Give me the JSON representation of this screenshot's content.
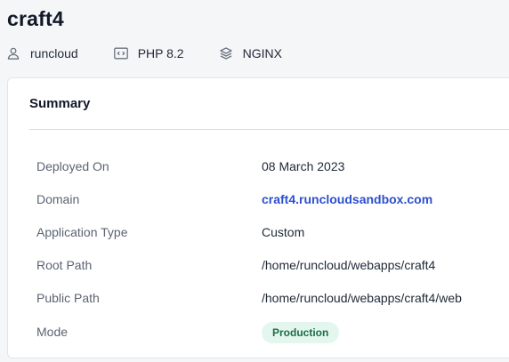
{
  "app": {
    "title": "craft4"
  },
  "meta": {
    "user": {
      "label": "runcloud",
      "icon": "user-icon"
    },
    "php": {
      "label": "PHP 8.2",
      "icon": "code-window-icon"
    },
    "server": {
      "label": "NGINX",
      "icon": "stack-layers-icon"
    }
  },
  "summary": {
    "title": "Summary",
    "deployed_on": {
      "label": "Deployed On",
      "value": "08 March 2023"
    },
    "domain": {
      "label": "Domain",
      "value": "craft4.runcloudsandbox.com"
    },
    "app_type": {
      "label": "Application Type",
      "value": "Custom"
    },
    "root_path": {
      "label": "Root Path",
      "value": "/home/runcloud/webapps/craft4"
    },
    "public_path": {
      "label": "Public Path",
      "value": "/home/runcloud/webapps/craft4/web"
    },
    "mode": {
      "label": "Mode",
      "value": "Production"
    }
  },
  "colors": {
    "link": "#2d4fcf",
    "badge_bg": "#e3f7ef",
    "badge_text": "#1f6b4b",
    "page_bg": "#f5f6f8"
  }
}
